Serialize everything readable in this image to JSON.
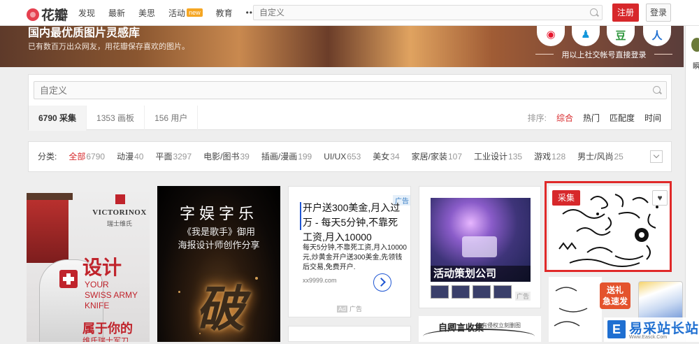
{
  "brand": {
    "name": "花瓣"
  },
  "nav": {
    "items": [
      "发现",
      "最新",
      "美思",
      "活动",
      "教育"
    ],
    "new_badge": "new",
    "more": "•••"
  },
  "top_search": {
    "placeholder": "自定义"
  },
  "auth": {
    "register": "注册",
    "login": "登录"
  },
  "banner": {
    "title": "国内最优质图片灵感库",
    "subtitle": "已有数百万出众网友，用花瓣保存喜欢的图片。",
    "social_note": "用以上社交帐号直接登录",
    "social": [
      {
        "icon": "weibo-icon",
        "glyph": "◉",
        "color": "#e6162d"
      },
      {
        "icon": "qq-icon",
        "glyph": "♟",
        "color": "#1296db"
      },
      {
        "icon": "douban-icon",
        "glyph": "豆",
        "color": "#2e963d"
      },
      {
        "icon": "renren-icon",
        "glyph": "人",
        "color": "#1f6fd1"
      }
    ]
  },
  "side": {
    "label": "瞬"
  },
  "search_panel": {
    "placeholder": "自定义",
    "tabs": [
      "6790 采集",
      "1353 画板",
      "156 用户"
    ],
    "sort_label": "排序:",
    "sort_options": [
      "综合",
      "热门",
      "匹配度",
      "时间"
    ]
  },
  "categories": {
    "label": "分类:",
    "items": [
      {
        "name": "全部",
        "count": "6790"
      },
      {
        "name": "动漫",
        "count": "40"
      },
      {
        "name": "平面",
        "count": "3297"
      },
      {
        "name": "电影/图书",
        "count": "39"
      },
      {
        "name": "插画/漫画",
        "count": "199"
      },
      {
        "name": "UI/UX",
        "count": "653"
      },
      {
        "name": "美女",
        "count": "34"
      },
      {
        "name": "家居/家装",
        "count": "107"
      },
      {
        "name": "工业设计",
        "count": "135"
      },
      {
        "name": "游戏",
        "count": "128"
      },
      {
        "name": "男士/风尚",
        "count": "25"
      }
    ]
  },
  "cards": {
    "victorinox": {
      "brand": "VICTORINOX",
      "brand_cn": "瑞士维氏",
      "big": "设计",
      "en_lines": [
        "YOUR",
        "SWISS ARMY",
        "KNIFE"
      ],
      "cn": "属于你的",
      "cn2": "维氏瑞士军刀"
    },
    "singer": {
      "title": "字娱字乐",
      "line1": "《我是歌手》御用",
      "line2": "海报设计师创作分享",
      "big": "破"
    },
    "ad": {
      "tag": "广告",
      "headline": "开户送300美金,月入过万 - 每天5分钟,不靠死工资,月入10000",
      "body": "每天5分钟,不靠死工资,月入10000元,炒黄金开户送300美金,先领钱后交易,免费开户.",
      "url": "xx9999.com",
      "foot_badge": "Ad",
      "foot": "广告"
    },
    "event": {
      "caption": "活动策划公司",
      "ad": "广告"
    },
    "event_next": {
      "title": "自卿言收集",
      "note": "如有侵权立刻删图"
    },
    "ornament": {
      "pin": "采集",
      "heart": "♥"
    },
    "promo": {
      "text": "送礼\n急速发"
    },
    "watermark": {
      "title": "易采站长站",
      "url": "Www.Easck.Com"
    }
  }
}
